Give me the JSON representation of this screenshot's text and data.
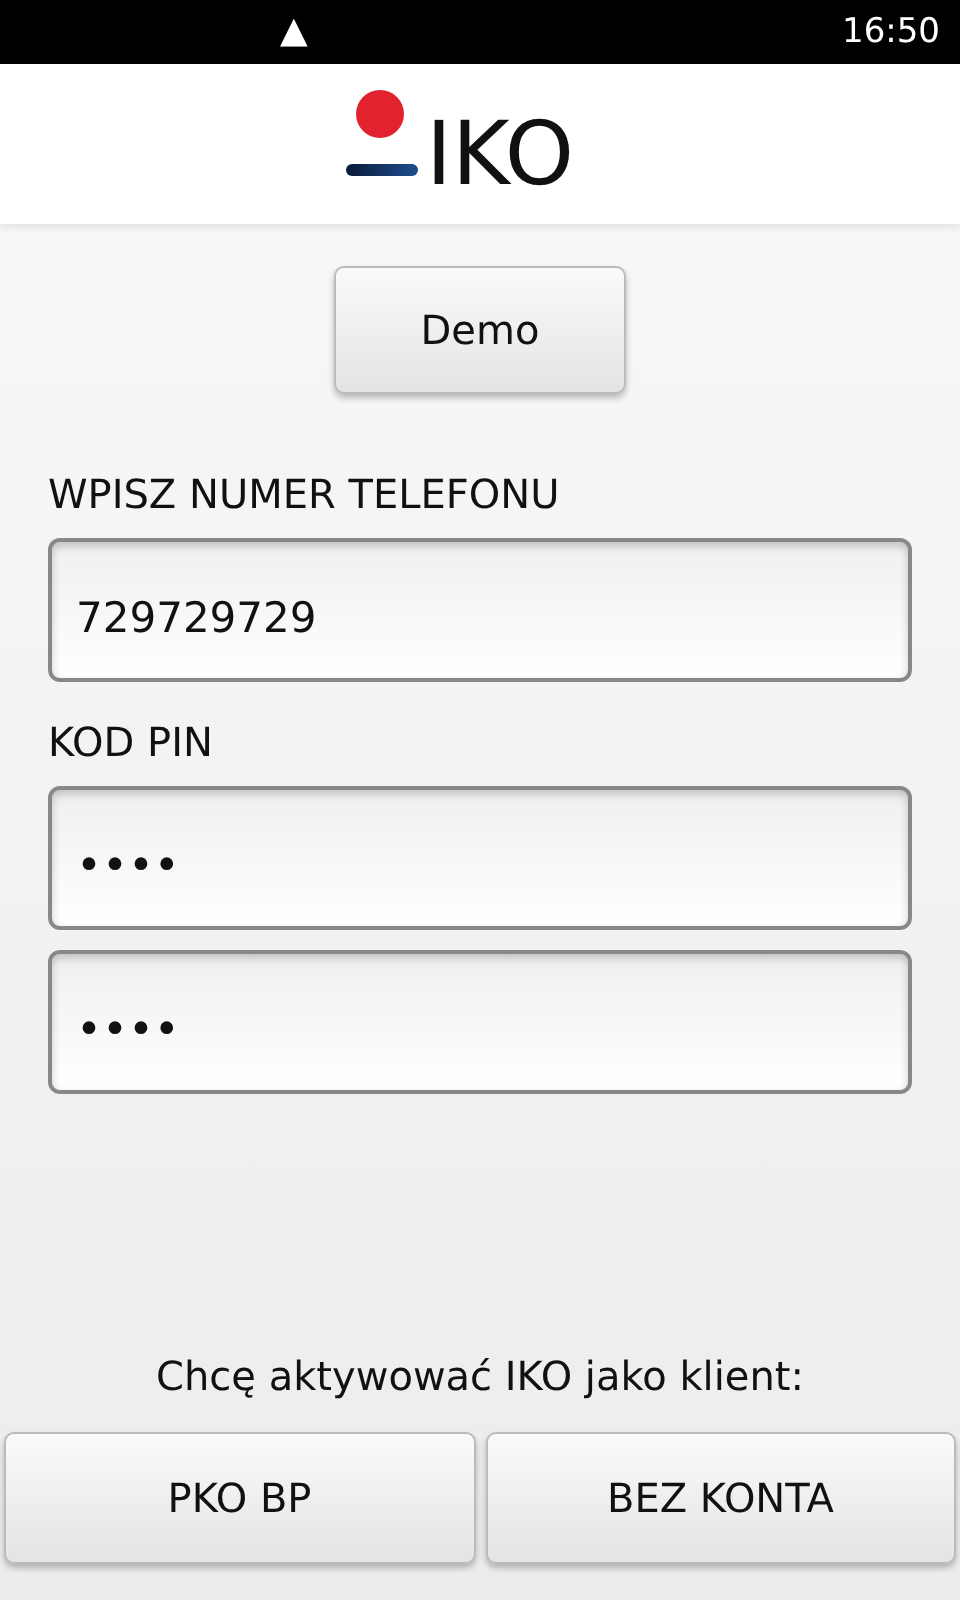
{
  "status_bar": {
    "icon": "▲",
    "time": "16:50"
  },
  "header": {
    "logo_text": "IKO"
  },
  "demo_button": "Demo",
  "phone": {
    "label": "WPISZ NUMER TELEFONU",
    "value": "729729729"
  },
  "pin": {
    "label": "KOD PIN",
    "fields": [
      {
        "value": "••••"
      },
      {
        "value": "••••"
      }
    ]
  },
  "prompt": "Chcę aktywować IKO jako klient:",
  "buttons": [
    "PKO BP",
    "BEZ KONTA"
  ]
}
